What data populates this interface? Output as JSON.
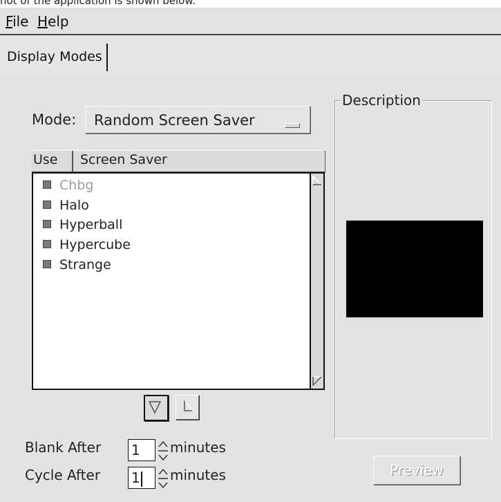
{
  "caption": "hot of the application is shown below.",
  "menubar": {
    "items": [
      {
        "mnemonic": "F",
        "rest": "ile"
      },
      {
        "mnemonic": "H",
        "rest": "elp"
      }
    ]
  },
  "tabs": [
    {
      "label": "Display Modes"
    }
  ],
  "mode": {
    "label": "Mode:",
    "value": "Random Screen Saver"
  },
  "list": {
    "headers": {
      "use": "Use",
      "name": "Screen Saver"
    },
    "items": [
      {
        "name": "Chbg",
        "enabled": false,
        "checked": true
      },
      {
        "name": "Halo",
        "enabled": true,
        "checked": true
      },
      {
        "name": "Hyperball",
        "enabled": true,
        "checked": true
      },
      {
        "name": "Hypercube",
        "enabled": true,
        "checked": true
      },
      {
        "name": "Strange",
        "enabled": true,
        "checked": true
      }
    ]
  },
  "blank": {
    "label": "Blank After",
    "value": "1",
    "unit": "minutes"
  },
  "cycle": {
    "label": "Cycle After",
    "value": "1",
    "unit": "minutes"
  },
  "description": {
    "legend": "Description",
    "preview_label": "Preview",
    "preview_color": "#000000"
  }
}
